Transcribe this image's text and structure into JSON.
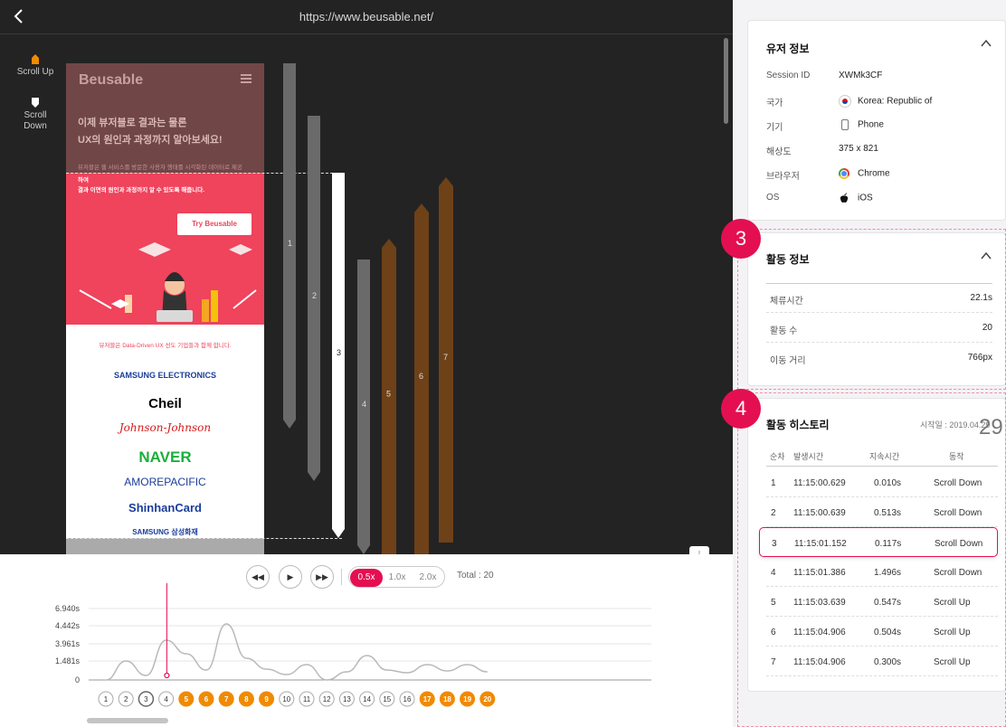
{
  "browser": {
    "url": "https://www.beusable.net/"
  },
  "side_tools": {
    "scroll_up": "Scroll Up",
    "scroll_down": "Scroll Down"
  },
  "site": {
    "logo": "Beusable",
    "headline1": "이제 뷰저블로 결과는 물론",
    "headline2": "UX의 원인과 과정까지 알아보세요!",
    "sub1": "뷰저블은 웹 서비스를 방문한 사용자 행태를 시각화된 데이터로 제공",
    "sub2": "하여",
    "sub3": "결과 이면의 원인과 과정까지 알 수 있도록 해줍니다.",
    "cta": "Try Beusable",
    "partners_title": "뷰저블은 Data-Driven UX 선도 기업들과 함께 합니다.",
    "partners": [
      "SAMSUNG ELECTRONICS",
      "Cheil",
      "Johnson-Johnson",
      "NAVER",
      "AMOREPACIFIC",
      "ShinhanCard",
      "SAMSUNG 삼성화재"
    ]
  },
  "scroll_bars": {
    "labels": [
      "1",
      "2",
      "3",
      "4",
      "5",
      "6",
      "7"
    ],
    "colors": {
      "scroll_up": "#6e4118",
      "scroll_down": "#6a6a6a",
      "selected": "#ffffff"
    }
  },
  "player": {
    "speeds": [
      "0.5x",
      "1.0x",
      "2.0x"
    ],
    "active_speed": "0.5x",
    "total": "Total : 20",
    "controls": [
      "rewind",
      "play",
      "fast-forward"
    ]
  },
  "chart_data": {
    "type": "line",
    "ytick_labels": [
      "6.940s",
      "4.442s",
      "3.961s",
      "1.481s",
      "0"
    ],
    "x": [
      1,
      2,
      3,
      4,
      5,
      6,
      7,
      8,
      9,
      10,
      11,
      12,
      13,
      14,
      15,
      16,
      17,
      18,
      19,
      20
    ],
    "durations": [
      0.01,
      0.513,
      0.117,
      1.496,
      0.547,
      0.504,
      0.3,
      0.2,
      1.0,
      0.5,
      0.3,
      0.6,
      0.8,
      0.5,
      0.9,
      0.3,
      0.6,
      0.4,
      0.8,
      0.5
    ],
    "selected_index": 3,
    "event_types": [
      "down",
      "down",
      "down",
      "down",
      "up",
      "up",
      "up",
      "up",
      "up",
      "down",
      "down",
      "down",
      "down",
      "down",
      "down",
      "down",
      "up",
      "up",
      "up",
      "up"
    ],
    "colors": {
      "line": "#b9b9b9",
      "marker": "#e40f51",
      "up": "#f08a00",
      "down": "#ffffff"
    }
  },
  "user_info": {
    "title": "유저 정보",
    "rows": [
      {
        "key": "Session ID",
        "value": "XWMk3CF"
      },
      {
        "key": "국가",
        "value": "Korea: Republic of"
      },
      {
        "key": "기기",
        "value": "Phone"
      },
      {
        "key": "해상도",
        "value": "375 x 821"
      },
      {
        "key": "브라우저",
        "value": "Chrome"
      },
      {
        "key": "OS",
        "value": "iOS"
      }
    ]
  },
  "activity_info": {
    "badge": "3",
    "title": "활동 정보",
    "rows": [
      {
        "key": "체류시간",
        "value": "22.1s"
      },
      {
        "key": "활동 수",
        "value": "20"
      },
      {
        "key": "이동 거리",
        "value": "766px"
      }
    ]
  },
  "history": {
    "badge": "4",
    "title": "활동 히스토리",
    "start_date": "시작일 : 2019.04.29",
    "headers": [
      "순차",
      "발생시간",
      "지속시간",
      "동작"
    ],
    "rows": [
      {
        "n": "1",
        "time": "11:15:00.629",
        "dur": "0.010s",
        "action": "Scroll Down"
      },
      {
        "n": "2",
        "time": "11:15:00.639",
        "dur": "0.513s",
        "action": "Scroll Down"
      },
      {
        "n": "3",
        "time": "11:15:01.152",
        "dur": "0.117s",
        "action": "Scroll Down"
      },
      {
        "n": "4",
        "time": "11:15:01.386",
        "dur": "1.496s",
        "action": "Scroll Down"
      },
      {
        "n": "5",
        "time": "11:15:03.639",
        "dur": "0.547s",
        "action": "Scroll Up"
      },
      {
        "n": "6",
        "time": "11:15:04.906",
        "dur": "0.504s",
        "action": "Scroll Up"
      },
      {
        "n": "7",
        "time": "11:15:04.906",
        "dur": "0.300s",
        "action": "Scroll Up"
      }
    ],
    "selected_row": 2,
    "overflow_text": "29"
  }
}
